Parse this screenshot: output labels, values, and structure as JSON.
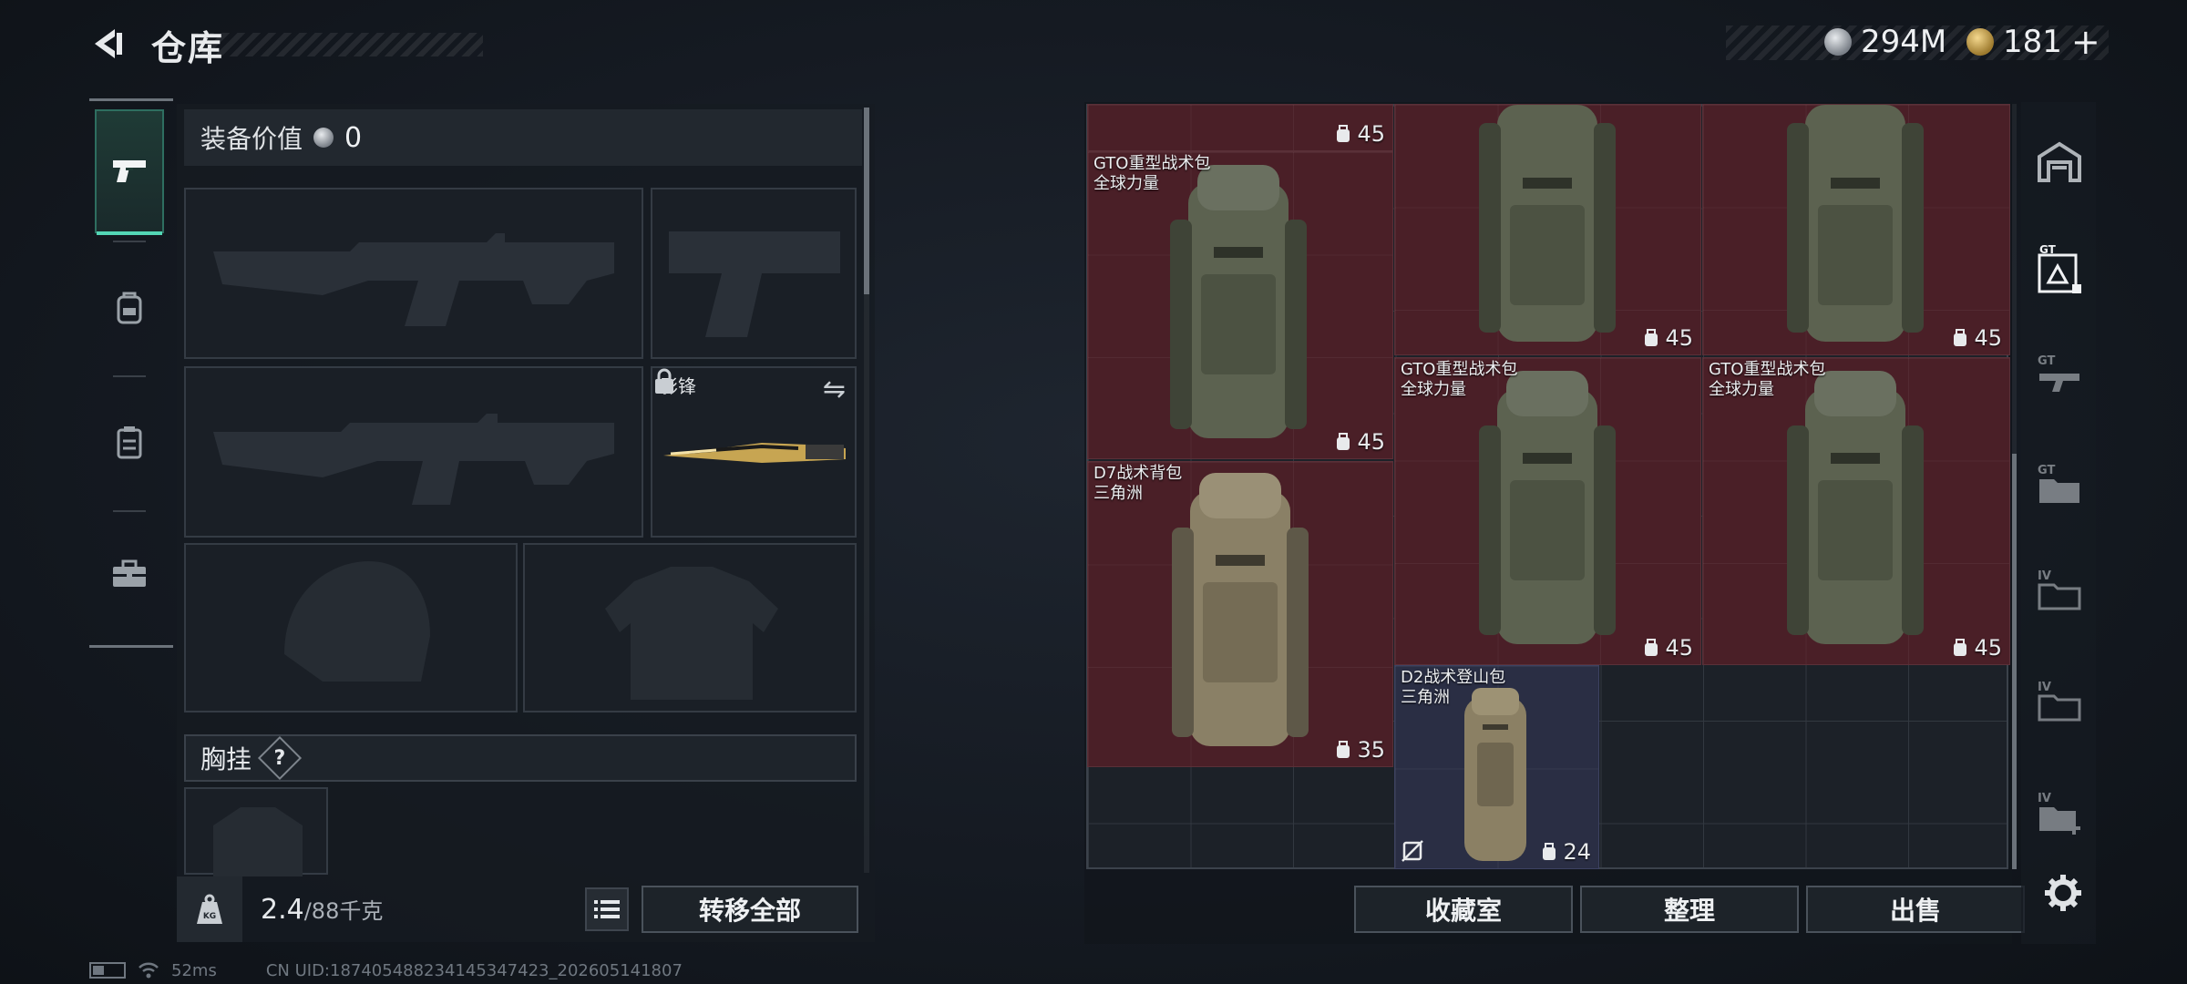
{
  "header": {
    "title": "仓库",
    "currency_silver": "294M",
    "currency_gold": "181",
    "plus_label": "+"
  },
  "equipment": {
    "value_label": "装备价值",
    "value": "0",
    "melee_name": "影锋",
    "chest_label": "胸挂",
    "chest_help": "?",
    "weight_current": "2.4",
    "weight_max": "/88千克",
    "transfer_all": "转移全部"
  },
  "storage": {
    "items": [
      {
        "name": "",
        "source": "",
        "capacity": "45"
      },
      {
        "name": "GTO重型战术包",
        "source": "全球力量",
        "capacity": "45"
      },
      {
        "name": "",
        "source": "",
        "capacity": "45"
      },
      {
        "name": "",
        "source": "",
        "capacity": "45"
      },
      {
        "name": "GTO重型战术包",
        "source": "全球力量",
        "capacity": "45"
      },
      {
        "name": "GTO重型战术包",
        "source": "全球力量",
        "capacity": "45"
      },
      {
        "name": "D7战术背包",
        "source": "三角洲",
        "capacity": "35"
      },
      {
        "name": "D2战术登山包",
        "source": "三角洲",
        "capacity": "24"
      }
    ],
    "buttons": {
      "collection": "收藏室",
      "organize": "整理",
      "sell": "出售"
    }
  },
  "status": {
    "ping": "52ms",
    "uid": "CN UID:18740548823414534742​3_202605141807"
  },
  "colors": {
    "accent": "#53d6b5",
    "item_red": "#4a1f27",
    "item_blue": "#2a2e44"
  }
}
